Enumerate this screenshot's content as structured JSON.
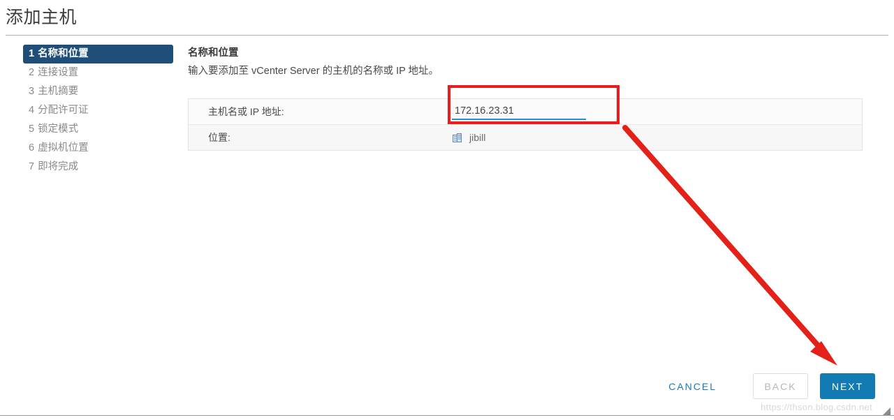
{
  "window": {
    "title": "添加主机"
  },
  "steps": [
    {
      "num": "1",
      "label": "名称和位置",
      "active": true
    },
    {
      "num": "2",
      "label": "连接设置",
      "active": false
    },
    {
      "num": "3",
      "label": "主机摘要",
      "active": false
    },
    {
      "num": "4",
      "label": "分配许可证",
      "active": false
    },
    {
      "num": "5",
      "label": "锁定模式",
      "active": false
    },
    {
      "num": "6",
      "label": "虚拟机位置",
      "active": false
    },
    {
      "num": "7",
      "label": "即将完成",
      "active": false
    }
  ],
  "content": {
    "title": "名称和位置",
    "description": "输入要添加至 vCenter Server 的主机的名称或 IP 地址。"
  },
  "form": {
    "hostname_label": "主机名或 IP 地址:",
    "hostname_value": "172.16.23.31",
    "hostname_placeholder": "",
    "location_label": "位置:",
    "location_icon": "datacenter-icon",
    "location_value": "jibill"
  },
  "footer": {
    "cancel_label": "CANCEL",
    "back_label": "BACK",
    "next_label": "NEXT"
  },
  "annotations": {
    "highlight_color": "#ea1c1c",
    "arrow_color": "#e32119"
  },
  "watermark": {
    "text": "https://thson.blog.csdn.net"
  },
  "colors": {
    "active_step_bg": "#1f4e79",
    "primary_button": "#127bb3",
    "link": "#1a7bb9",
    "input_underline": "#2a8fd4"
  }
}
